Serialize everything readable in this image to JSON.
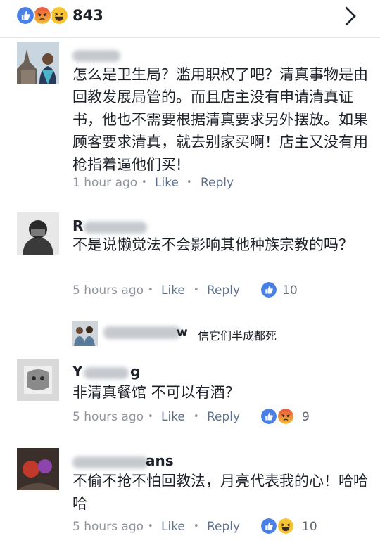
{
  "header": {
    "reaction_total": "843",
    "reaction_icons": [
      "like-icon",
      "angry-icon",
      "haha-icon"
    ]
  },
  "comments": [
    {
      "name_visible": "",
      "text": "怎么是卫生局？滥用职权了吧？清真事物是由回教发展局管的。而且店主没有申请清真证书，他也不需要根据清真要求另外摆放。如果顾客要求清真，就去别家买啊！店主又没有用枪指着逼他们买!",
      "time": "1 hour ago",
      "like": "Like",
      "reply": "Reply",
      "reaction_count": ""
    },
    {
      "name_visible": "R",
      "text": "不是说懒觉法不会影响其他种族宗教的吗？",
      "time": "5 hours ago",
      "like": "Like",
      "reply": "Reply",
      "reaction_count": "10"
    },
    {
      "name_visible": "Y",
      "name_suffix": "g",
      "text": "非清真餐馆 不可以有酒？",
      "time": "5 hours ago",
      "like": "Like",
      "reply": "Reply",
      "reaction_count": "9"
    },
    {
      "name_visible": "ans",
      "text": "不偷不抢不怕回教法，月亮代表我的心！哈哈哈",
      "time": "5 hours ago",
      "like": "Like",
      "reply": "Reply",
      "reaction_count": "10"
    }
  ],
  "reply_preview": {
    "name_suffix": "w",
    "text": "信它们半成都死"
  },
  "colors": {
    "like_blue": "#4a7fe3",
    "angry_red": "#e8543c",
    "haha_yellow": "#f7c434",
    "meta_gray": "#90949c",
    "link_gray": "#5d6f8e"
  }
}
